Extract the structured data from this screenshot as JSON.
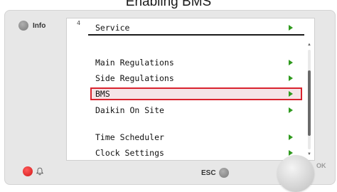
{
  "caption": "Enabling BMS",
  "info_button": {
    "label": "Info"
  },
  "screen": {
    "page_number": "4",
    "header": {
      "title": "Service"
    },
    "menu_items": [
      {
        "label": "Main Regulations",
        "selected": false
      },
      {
        "label": "Side Regulations",
        "selected": false
      },
      {
        "label": "BMS",
        "selected": true
      },
      {
        "label": "Daikin On Site",
        "selected": false
      },
      {
        "label": "Time Scheduler",
        "selected": false
      },
      {
        "label": "Clock Settings",
        "selected": false
      }
    ],
    "scrollbar": {
      "position": 0.6
    }
  },
  "bottom": {
    "esc_label": "ESC",
    "ok_label": "OK"
  },
  "icons": {
    "info": "gray-indicator-icon",
    "alarm_led": "red-led-icon",
    "bell": "bell-icon",
    "esc": "gray-indicator-icon",
    "arrow": "green-right-arrow-icon"
  },
  "colors": {
    "arrow": "#2f9a1e",
    "selection_border": "#d9232e",
    "selection_fill": "#f5e4e7",
    "alarm": "#d21919"
  }
}
